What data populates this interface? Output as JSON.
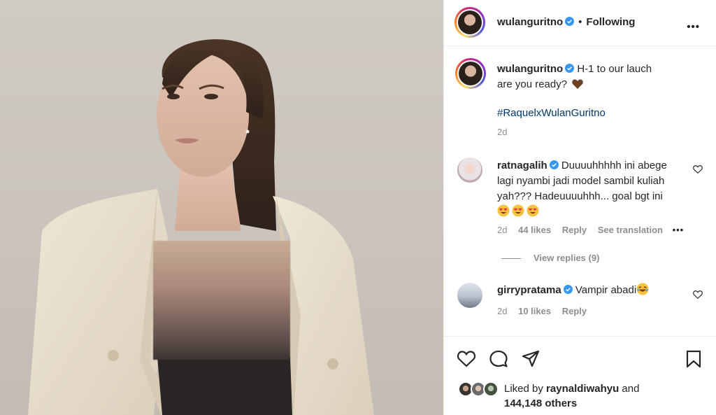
{
  "post": {
    "username": "wulanguritno",
    "dot": "•",
    "following": "Following",
    "more": "•••",
    "caption_line1": "H-1 to our lauch",
    "caption_line2": "are you ready?",
    "hashtag": "#RaquelxWulanGuritno",
    "time": "2d"
  },
  "comments": [
    {
      "username": "ratnagalih",
      "text_line1": "Duuuuhhhhh ini abege",
      "text_line2": "lagi nyambi jadi model sambil kuliah",
      "text_line3": "yah??? Hadeuuuuhhh... goal bgt ini",
      "time": "2d",
      "likes": "44 likes",
      "reply": "Reply",
      "translate": "See translation",
      "more": "•••",
      "view_replies": "View replies (9)"
    },
    {
      "username": "girrypratama",
      "text": "Vampir abadi",
      "time": "2d",
      "likes": "10 likes",
      "reply": "Reply"
    }
  ],
  "likes": {
    "prefix": "Liked by",
    "user": "raynaldiwahyu",
    "and": "and",
    "others": "144,148 others"
  },
  "icons": [
    "heart-icon",
    "comment-icon",
    "share-icon",
    "bookmark-icon",
    "verified-icon",
    "more-icon"
  ],
  "colors": {
    "verified": "#3897f0",
    "link": "#00376b",
    "muted": "#8e8e8e"
  }
}
